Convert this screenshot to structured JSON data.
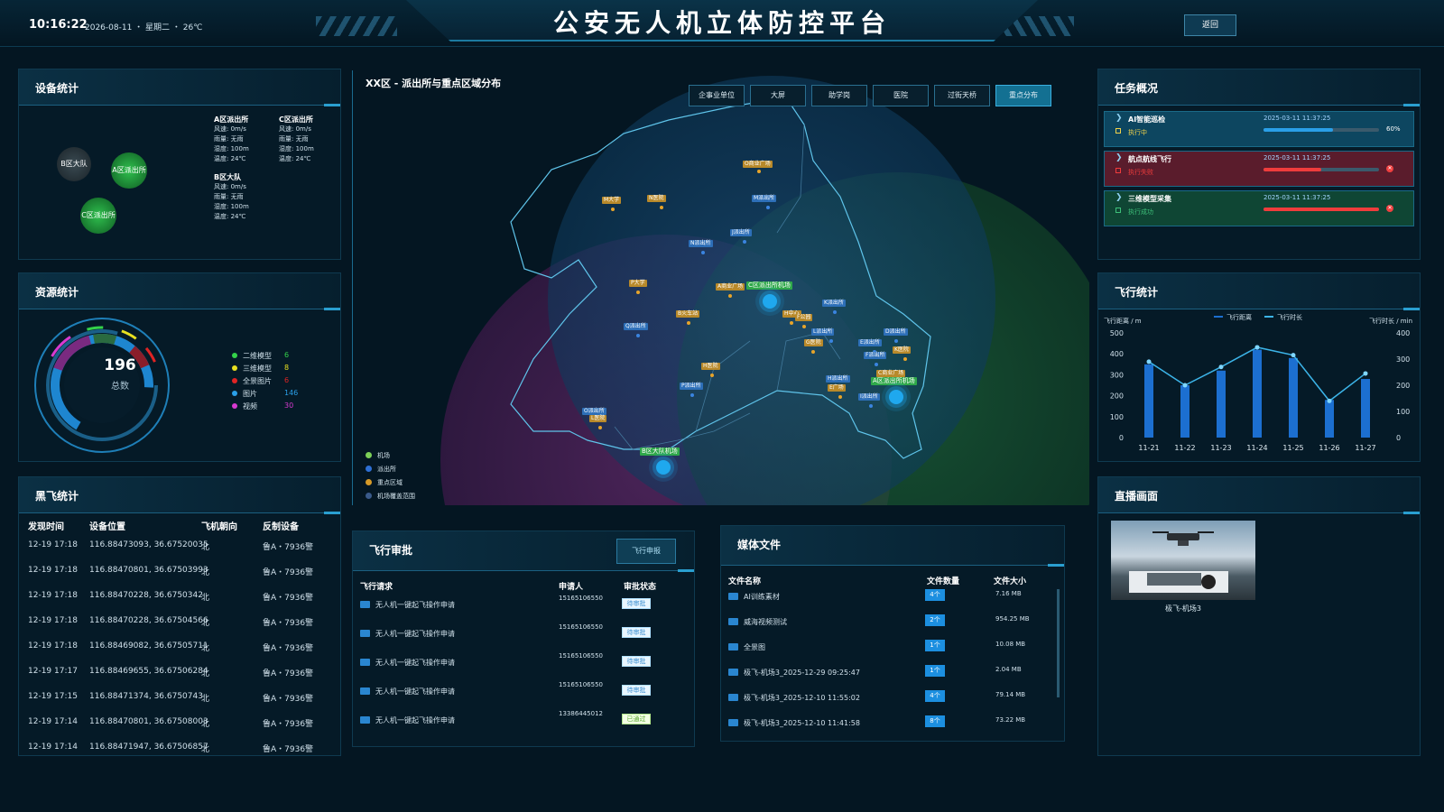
{
  "header": {
    "time": "10:16:22",
    "date_weather": "2026-08-11 ・ 星期二   ・ 26℃",
    "title": "公安无人机立体防控平台",
    "back_label": "返回"
  },
  "device_stats": {
    "title": "设备统计",
    "bubbles": [
      "B区大队",
      "A区派出所",
      "C区派出所"
    ],
    "info": [
      {
        "name": "A区派出所",
        "lines": [
          "风速: 0m/s",
          "雨量: 无雨",
          "湿度: 100m",
          "温度: 24℃"
        ]
      },
      {
        "name": "C区派出所",
        "lines": [
          "风速: 0m/s",
          "雨量: 无雨",
          "湿度: 100m",
          "温度: 24℃"
        ]
      },
      {
        "name": "B区大队",
        "lines": [
          "风速: 0m/s",
          "雨量: 无雨",
          "湿度: 100m",
          "温度: 24℃"
        ]
      }
    ]
  },
  "resource_stats": {
    "title": "资源统计",
    "total": "196",
    "total_label": "总数",
    "items": [
      {
        "name": "二维模型",
        "value": "6",
        "color": "#34d24a"
      },
      {
        "name": "三维模型",
        "value": "8",
        "color": "#e8e020"
      },
      {
        "name": "全景图片",
        "value": "6",
        "color": "#e02424"
      },
      {
        "name": "图片",
        "value": "146",
        "color": "#2a9fe8"
      },
      {
        "name": "视频",
        "value": "30",
        "color": "#d83ad0"
      }
    ]
  },
  "black_fly": {
    "title": "黑飞统计",
    "columns": [
      "发现时间",
      "设备位置",
      "飞机朝向",
      "反制设备"
    ],
    "rows": [
      [
        "12-19 17:18",
        "116.88473093, 36.67520035",
        "北",
        "鲁A・7936警"
      ],
      [
        "12-19 17:18",
        "116.88470801, 36.67503993",
        "北",
        "鲁A・7936警"
      ],
      [
        "12-19 17:18",
        "116.88470228, 36.6750342",
        "北",
        "鲁A・7936警"
      ],
      [
        "12-19 17:18",
        "116.88470228, 36.67504566",
        "北",
        "鲁A・7936警"
      ],
      [
        "12-19 17:18",
        "116.88469082, 36.67505711",
        "北",
        "鲁A・7936警"
      ],
      [
        "12-19 17:17",
        "116.88469655, 36.67506284",
        "北",
        "鲁A・7936警"
      ],
      [
        "12-19 17:15",
        "116.88471374, 36.6750743",
        "北",
        "鲁A・7936警"
      ],
      [
        "12-19 17:14",
        "116.88470801, 36.67508003",
        "北",
        "鲁A・7936警"
      ],
      [
        "12-19 17:14",
        "116.88471947, 36.67506857",
        "北",
        "鲁A・7936警"
      ]
    ]
  },
  "map": {
    "title": "XX区 - 派出所与重点区域分布",
    "tabs": [
      "企事业单位",
      "大屏",
      "助学岗",
      "医院",
      "过街天桥",
      "重点分布"
    ],
    "labels": {
      "o_commerce": "O商业广场",
      "m_univ": "M大学",
      "n_hosp": "N医院",
      "m_station": "M派出所",
      "j_station": "J派出所",
      "n_station": "N派出所",
      "p_univ": "P大学",
      "a_commerce": "A商业广场",
      "c_airport": "C区派出所机场",
      "k_station": "K派出所",
      "b_hosp": "B火车站",
      "h_hosp": "H中心",
      "f_hosp": "F公园",
      "q_station": "Q派出所",
      "l_station": "L派出所",
      "g_hosp": "G医院",
      "e_station": "E派出所",
      "d_station": "D派出所",
      "k_hosp": "K医院",
      "f_station": "F派出所",
      "h_hosp2": "H医院",
      "p_station": "P派出所",
      "h_station": "H派出所",
      "c_commerce": "C商业广场",
      "e_market": "E广场",
      "a_airport": "A区派出所机场",
      "i_station": "I派出所",
      "o_station": "O派出所",
      "l_hosp": "L医院",
      "b_airport": "B区大队机场",
      "misc1": "医院",
      "misc2": "G派出所"
    },
    "legend": [
      {
        "label": "机场",
        "color": "#7ccf58"
      },
      {
        "label": "派出所",
        "color": "#2e6fd4"
      },
      {
        "label": "重点区域",
        "color": "#d79a28"
      },
      {
        "label": "机场覆盖范围",
        "color": "#3a5a8a"
      }
    ]
  },
  "approval": {
    "title": "飞行审批",
    "button": "飞行申报",
    "columns": [
      "飞行请求",
      "申请人",
      "审批状态"
    ],
    "rows": [
      {
        "req": "无人机一键起飞操作申请",
        "user": "15165106550",
        "status": "待审批",
        "ok": false
      },
      {
        "req": "无人机一键起飞操作申请",
        "user": "15165106550",
        "status": "待审批",
        "ok": false
      },
      {
        "req": "无人机一键起飞操作申请",
        "user": "15165106550",
        "status": "待审批",
        "ok": false
      },
      {
        "req": "无人机一键起飞操作申请",
        "user": "15165106550",
        "status": "待审批",
        "ok": false
      },
      {
        "req": "无人机一键起飞操作申请",
        "user": "13386445012",
        "status": "已通过",
        "ok": true
      }
    ]
  },
  "media": {
    "title": "媒体文件",
    "columns": [
      "文件名称",
      "文件数量",
      "文件大小"
    ],
    "rows": [
      {
        "name": "AI训练素材",
        "count": "4个",
        "size": "7.16 MB"
      },
      {
        "name": "威海视频测试",
        "count": "2个",
        "size": "954.25 MB"
      },
      {
        "name": "全景图",
        "count": "1个",
        "size": "10.08 MB"
      },
      {
        "name": "极飞-机场3_2025-12-29 09:25:47",
        "count": "1个",
        "size": "2.04 MB"
      },
      {
        "name": "极飞-机场3_2025-12-10 11:55:02",
        "count": "4个",
        "size": "79.14 MB"
      },
      {
        "name": "极飞-机场3_2025-12-10 11:41:58",
        "count": "8个",
        "size": "73.22 MB"
      }
    ]
  },
  "tasks": {
    "title": "任务概况",
    "items": [
      {
        "name": "AI智能巡检",
        "status": "执行中",
        "time": "2025-03-11 11:37:25",
        "progress": 0.6,
        "pct_label": "60%",
        "bg": "#0d4660",
        "bar": "#2a9fe8",
        "status_color": "#f0d24a",
        "failed": false
      },
      {
        "name": "航点航线飞行",
        "status": "执行失败",
        "time": "2025-03-11 11:37:25",
        "progress": 0.5,
        "pct_label": "",
        "bg": "#5a1c2c",
        "bar": "#ef3c3c",
        "status_color": "#ef3c3c",
        "failed": true
      },
      {
        "name": "三维模型采集",
        "status": "执行成功",
        "time": "2025-03-11 11:37:25",
        "progress": 1.0,
        "pct_label": "",
        "bg": "#0f4634",
        "bar": "#ef3c3c",
        "status_color": "#3ec07a",
        "failed": true
      }
    ]
  },
  "flight_stats": {
    "title": "飞行统计",
    "legend_distance": "飞行距离",
    "legend_duration": "飞行时长",
    "left_axis_label": "飞行距离 / m",
    "right_axis_label": "飞行时长 / min"
  },
  "chart_data": {
    "type": "bar",
    "categories": [
      "11-21",
      "11-22",
      "11-23",
      "11-24",
      "11-25",
      "11-26",
      "11-27"
    ],
    "series": [
      {
        "name": "飞行距离",
        "type": "bar",
        "values": [
          350,
          250,
          320,
          420,
          380,
          180,
          280
        ],
        "axis": "left"
      },
      {
        "name": "飞行时长",
        "type": "line",
        "values": [
          290,
          200,
          270,
          345,
          315,
          140,
          245
        ],
        "axis": "right"
      }
    ],
    "ylim_left": [
      0,
      500
    ],
    "yticks_left": [
      "0",
      "100",
      "200",
      "300",
      "400",
      "500"
    ],
    "ylim_right": [
      0,
      400
    ],
    "yticks_right": [
      "0",
      "100",
      "200",
      "300",
      "400"
    ],
    "xlabel": "",
    "ylabel": "飞行距离 / m",
    "ylabel_right": "飞行时长 / min",
    "grid": false
  },
  "live": {
    "title": "直播画面",
    "camera": "极飞-机场3"
  }
}
